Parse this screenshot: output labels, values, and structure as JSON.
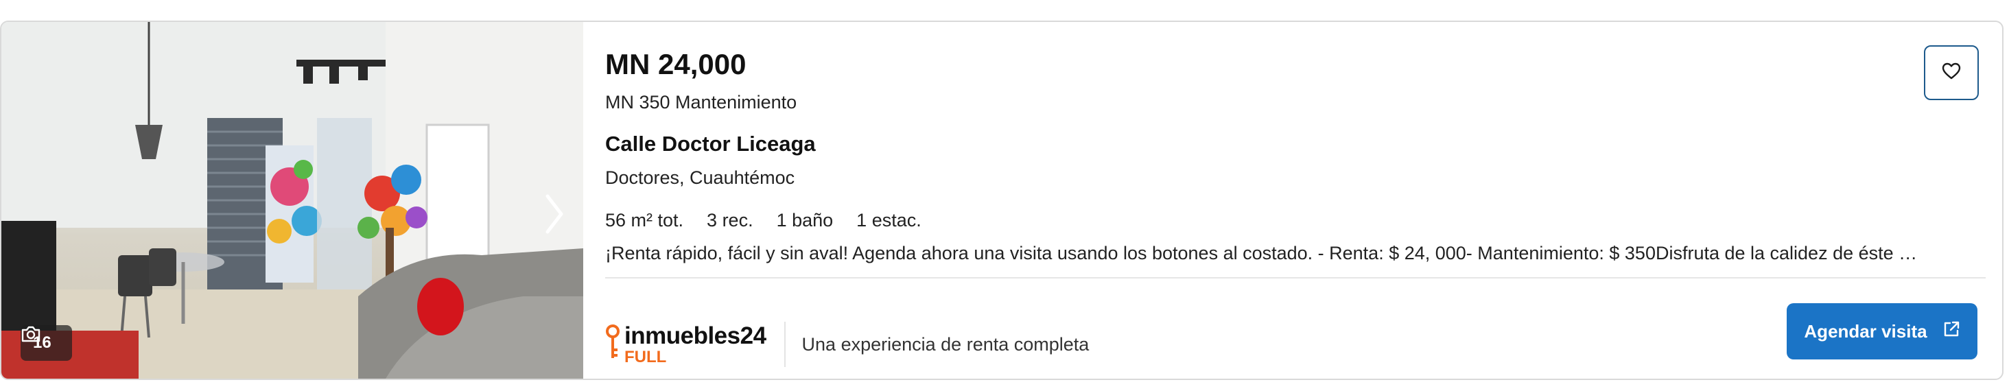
{
  "listing": {
    "price": "MN 24,000",
    "maintenance": "MN 350 Mantenimiento",
    "street": "Calle Doctor Liceaga",
    "neighborhood": "Doctores, Cuauhtémoc",
    "features": [
      "56 m² tot.",
      "3 rec.",
      "1 baño",
      "1 estac."
    ],
    "description": "¡Renta rápido, fácil y sin aval! Agenda ahora una visita usando los botones al costado. - Renta: $ 24, 000- Mantenimiento: $ 350Disfruta de la calidez de éste …"
  },
  "photo": {
    "count": "16",
    "camera_icon": "camera-icon",
    "next_icon": "chevron-right-icon"
  },
  "favorite": {
    "icon": "heart-icon"
  },
  "brand": {
    "name": "inmuebles24",
    "sub": "FULL",
    "tagline": "Una experiencia de renta completa",
    "color": "#f26b1d"
  },
  "cta": {
    "label": "Agendar visita",
    "icon": "external-link-icon",
    "color": "#1b74c6"
  }
}
